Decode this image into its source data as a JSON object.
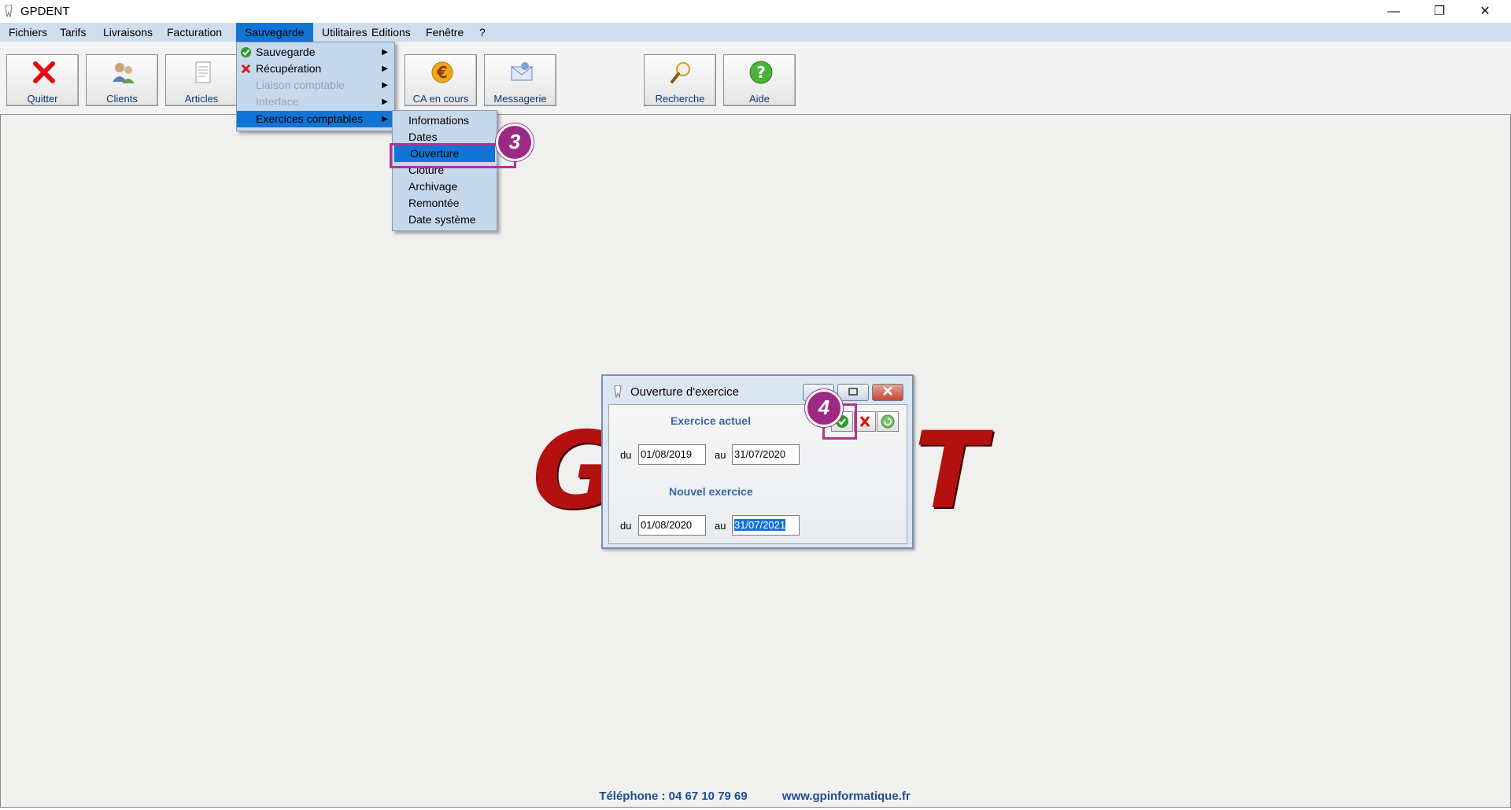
{
  "app": {
    "title": "GPDENT"
  },
  "window_controls": {
    "minimize": "—",
    "restore": "❐",
    "close": "✕"
  },
  "menubar": [
    "Fichiers",
    "Tarifs",
    "Livraisons",
    "Facturation",
    "Sauvegarde",
    "Utilitaires",
    "Editions",
    "Fenêtre",
    "?"
  ],
  "toolbar": {
    "quitter": "Quitter",
    "clients": "Clients",
    "articles": "Articles",
    "ca": "CA en cours",
    "messagerie": "Messagerie",
    "recherche": "Recherche",
    "aide": "Aide"
  },
  "sauvegarde_menu": [
    "Sauvegarde",
    "Récupération",
    "Liaison comptable",
    "Interface",
    "Exercices comptables"
  ],
  "exercices_menu": [
    "Informations",
    "Dates",
    "Ouverture",
    "Clôture",
    "Archivage",
    "Remontée",
    "Date système"
  ],
  "annotations": {
    "step3": "3",
    "step4": "4"
  },
  "dialog": {
    "title": "Ouverture d'exercice",
    "current_title": "Exercice actuel",
    "new_title": "Nouvel exercice",
    "du": "du",
    "au": "au",
    "current_from": "01/08/2019",
    "current_to": "31/07/2020",
    "new_from": "01/08/2020",
    "new_to": "31/07/2021"
  },
  "logo": {
    "left": "G",
    "right": "T"
  },
  "footer": {
    "phone": "Téléphone : 04 67 10 79 69",
    "website": "www.gpinformatique.fr"
  },
  "colors": {
    "accent": "#1374d8",
    "annotation": "#9c2a84",
    "footer_text": "#1f4e96",
    "logo": "#b51010"
  },
  "icons": [
    "tooth-icon",
    "red-x-icon",
    "clients-icon",
    "document-icon",
    "euro-icon",
    "messagerie-icon",
    "magnifier-icon",
    "help-icon",
    "green-check-icon",
    "cancel-icon",
    "refresh-icon"
  ]
}
